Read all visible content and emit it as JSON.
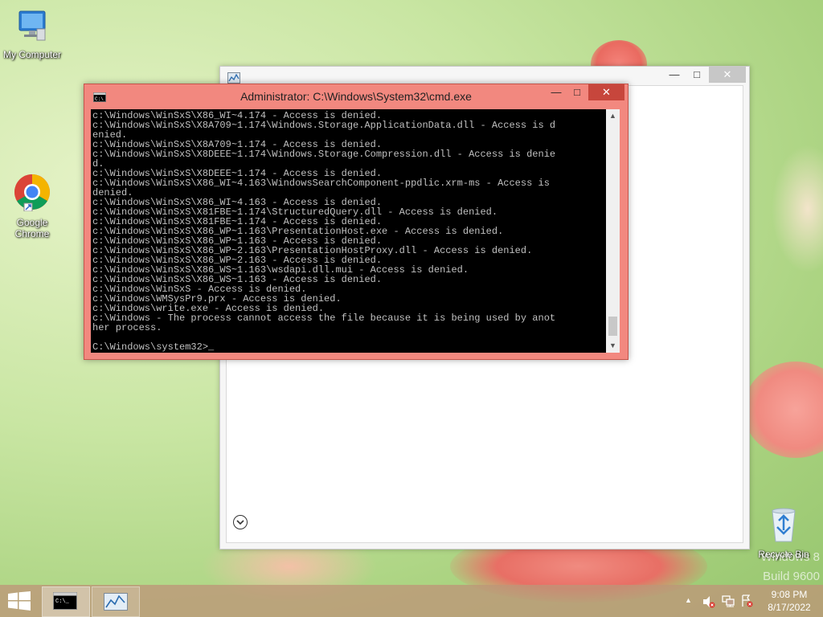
{
  "desktop": {
    "icons": [
      {
        "label": "My Computer",
        "icon": "computer-icon"
      },
      {
        "label": "Google Chrome",
        "icon": "chrome-icon"
      },
      {
        "label": "Recycle Bin",
        "icon": "recycle-bin-icon"
      }
    ],
    "watermark": [
      "Windows 8",
      "Build 9600"
    ]
  },
  "background_window": {
    "minimize": "—",
    "maximize": "□",
    "close": "✕"
  },
  "cmd": {
    "title": "Administrator: C:\\Windows\\System32\\cmd.exe",
    "minimize": "—",
    "maximize": "□",
    "close": "✕",
    "output_lines": [
      "c:\\Windows\\WinSxS\\X86_WI~4.174 - Access is denied.",
      "c:\\Windows\\WinSxS\\X8A709~1.174\\Windows.Storage.ApplicationData.dll - Access is d",
      "enied.",
      "c:\\Windows\\WinSxS\\X8A709~1.174 - Access is denied.",
      "c:\\Windows\\WinSxS\\X8DEEE~1.174\\Windows.Storage.Compression.dll - Access is denie",
      "d.",
      "c:\\Windows\\WinSxS\\X8DEEE~1.174 - Access is denied.",
      "c:\\Windows\\WinSxS\\X86_WI~4.163\\WindowsSearchComponent-ppdlic.xrm-ms - Access is",
      "denied.",
      "c:\\Windows\\WinSxS\\X86_WI~4.163 - Access is denied.",
      "c:\\Windows\\WinSxS\\X81FBE~1.174\\StructuredQuery.dll - Access is denied.",
      "c:\\Windows\\WinSxS\\X81FBE~1.174 - Access is denied.",
      "c:\\Windows\\WinSxS\\X86_WP~1.163\\PresentationHost.exe - Access is denied.",
      "c:\\Windows\\WinSxS\\X86_WP~1.163 - Access is denied.",
      "c:\\Windows\\WinSxS\\X86_WP~2.163\\PresentationHostProxy.dll - Access is denied.",
      "c:\\Windows\\WinSxS\\X86_WP~2.163 - Access is denied.",
      "c:\\Windows\\WinSxS\\X86_WS~1.163\\wsdapi.dll.mui - Access is denied.",
      "c:\\Windows\\WinSxS\\X86_WS~1.163 - Access is denied.",
      "c:\\Windows\\WinSxS - Access is denied.",
      "c:\\Windows\\WMSysPr9.prx - Access is denied.",
      "c:\\Windows\\write.exe - Access is denied.",
      "c:\\Windows - The process cannot access the file because it is being used by anot",
      "her process.",
      "",
      "C:\\Windows\\system32>_"
    ]
  },
  "taskbar": {
    "time": "9:08 PM",
    "date": "8/17/2022",
    "buttons": [
      {
        "icon": "cmd-icon"
      },
      {
        "icon": "resource-monitor-icon"
      }
    ],
    "tray": [
      "show-hidden-icons-icon",
      "volume-muted-icon",
      "network-icon",
      "action-center-icon"
    ]
  },
  "colors": {
    "cmd_frame": "#f2887f",
    "cmd_close": "#c7463c",
    "console_bg": "#000000",
    "console_text": "#c0c0c0"
  }
}
